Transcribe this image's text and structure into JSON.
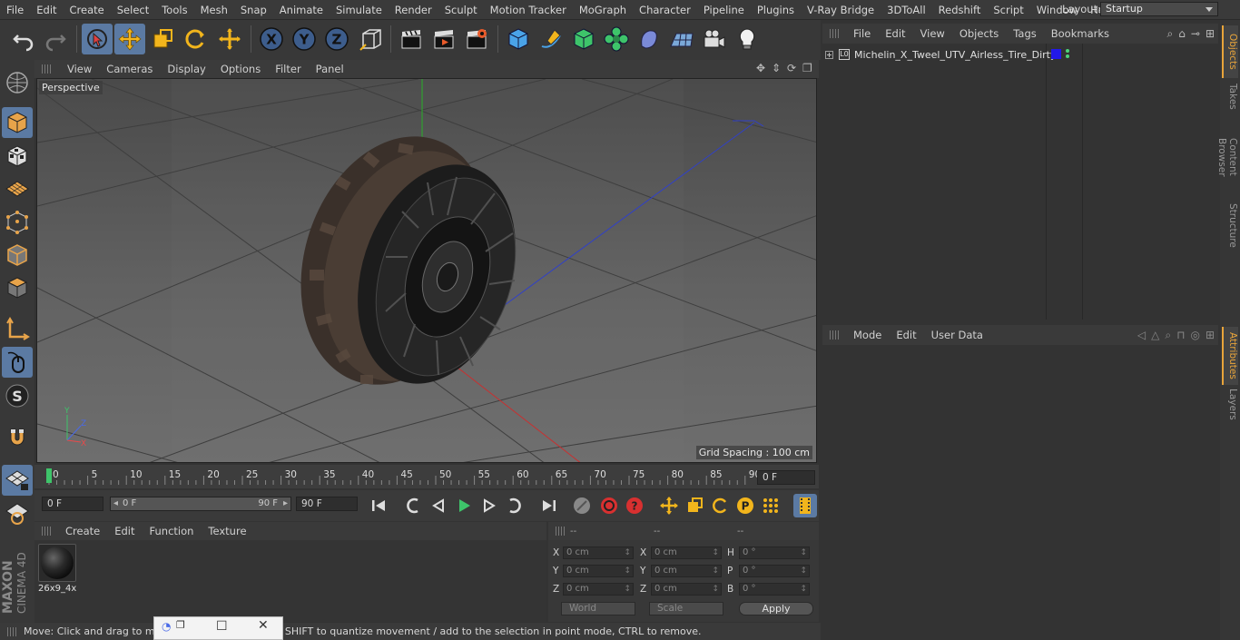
{
  "menu": [
    "File",
    "Edit",
    "Create",
    "Select",
    "Tools",
    "Mesh",
    "Snap",
    "Animate",
    "Simulate",
    "Render",
    "Sculpt",
    "Motion Tracker",
    "MoGraph",
    "Character",
    "Pipeline",
    "Plugins",
    "V-Ray Bridge",
    "3DToAll",
    "Redshift",
    "Script",
    "Window",
    "Help"
  ],
  "layout": {
    "label": "Layout:",
    "value": "Startup"
  },
  "viewport": {
    "menu": [
      "View",
      "Cameras",
      "Display",
      "Options",
      "Filter",
      "Panel"
    ],
    "label": "Perspective",
    "grid_spacing": "Grid Spacing : 100 cm"
  },
  "timeline": {
    "ticks": [
      "0",
      "5",
      "10",
      "15",
      "20",
      "25",
      "30",
      "35",
      "40",
      "45",
      "50",
      "55",
      "60",
      "65",
      "70",
      "75",
      "80",
      "85",
      "90"
    ],
    "current_frame": "0 F",
    "start_frame": "0 F",
    "range_start": "0 F",
    "range_end": "90 F",
    "end_frame": "90 F"
  },
  "material_manager": {
    "menu": [
      "Create",
      "Edit",
      "Function",
      "Texture"
    ],
    "material_name": "26x9_4x"
  },
  "coordinates": {
    "header": [
      "--",
      "--",
      "--"
    ],
    "rows": [
      {
        "a": "X",
        "v1": "0 cm",
        "b": "X",
        "v2": "0 cm",
        "c": "H",
        "v3": "0 °"
      },
      {
        "a": "Y",
        "v1": "0 cm",
        "b": "Y",
        "v2": "0 cm",
        "c": "P",
        "v3": "0 °"
      },
      {
        "a": "Z",
        "v1": "0 cm",
        "b": "Z",
        "v2": "0 cm",
        "c": "B",
        "v3": "0 °"
      }
    ],
    "space": "World",
    "mode": "Scale",
    "apply": "Apply"
  },
  "status": "Move: Click and drag to move elements. Hold down SHIFT to quantize movement / add to the selection in point mode, CTRL to remove.",
  "object_manager": {
    "menu": [
      "File",
      "Edit",
      "View",
      "Objects",
      "Tags",
      "Bookmarks"
    ],
    "object_name": "Michelin_X_Tweel_UTV_Airless_Tire_Dirty",
    "object_color": "#2218e8"
  },
  "attribute_manager": {
    "menu": [
      "Mode",
      "Edit",
      "User Data"
    ]
  },
  "side_tabs": [
    "Objects",
    "Takes",
    "Content Browser",
    "Structure",
    "Attributes",
    "Layers"
  ],
  "brand": {
    "maxon": "MAXON",
    "product": "CINEMA 4D"
  }
}
